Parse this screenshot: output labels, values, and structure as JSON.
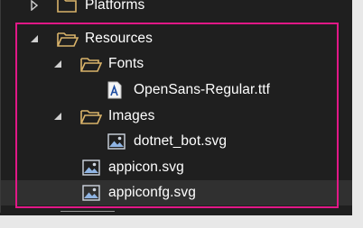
{
  "tree": {
    "top_partial": {
      "label": "Platforms",
      "icon": "folder-icon"
    },
    "items": [
      {
        "label": "Resources",
        "icon": "folder-open-icon",
        "expanded": true,
        "level": 0
      },
      {
        "label": "Fonts",
        "icon": "folder-open-icon",
        "expanded": true,
        "level": 1
      },
      {
        "label": "OpenSans-Regular.ttf",
        "icon": "font-file-icon",
        "level": 2
      },
      {
        "label": "Images",
        "icon": "folder-open-icon",
        "expanded": true,
        "level": 1
      },
      {
        "label": "dotnet_bot.svg",
        "icon": "image-file-icon",
        "level": 2
      },
      {
        "label": "appicon.svg",
        "icon": "image-file-icon",
        "level": 1
      },
      {
        "label": "appiconfg.svg",
        "icon": "image-file-icon",
        "level": 1,
        "selected": true
      }
    ]
  },
  "colors": {
    "background": "#1f1f1f",
    "folder": "#d9b36a",
    "highlight_border": "#e11887",
    "selected_row": "#303030",
    "text": "#ffffff"
  }
}
